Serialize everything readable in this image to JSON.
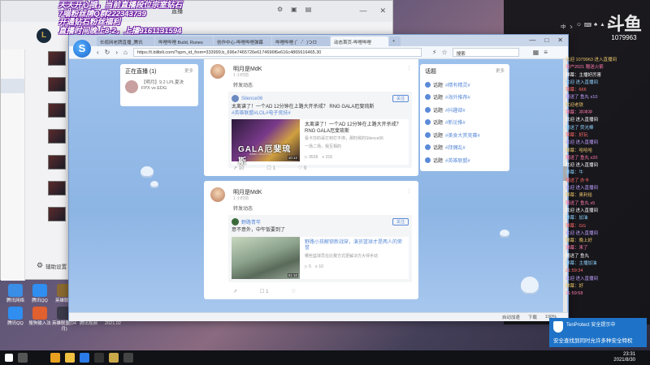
{
  "overlay": {
    "lines": [
      "天天开心哦，当前直播段位宗室钻石",
      "7喵粉丝牌Q群222343739",
      "开通钻石粉丝福利",
      "直播时间晚上8-2，上播9161131594"
    ]
  },
  "back_window": {
    "title": "英雄联盟",
    "tab_live": "直播",
    "footer_settings": "辅助设置"
  },
  "desktop_icons": [
    {
      "label": "腾讯网络"
    },
    {
      "label": "腾讯QQ"
    },
    {
      "label": "英雄联盟"
    },
    {
      "label": "腾讯QQ"
    },
    {
      "label": "搜狗输入法"
    },
    {
      "label": "英雄联盟(04月)"
    },
    {
      "label": "腾讯视频"
    },
    {
      "label": "2021.02"
    }
  ],
  "right_panel": {
    "brand": "斗鱼",
    "viewers": "1079963",
    "tray": [
      "中",
      "ゝ",
      "☺",
      "⌨",
      "♣",
      "▲",
      "■"
    ],
    "chat_lines": [
      "欢迎 1079963 进入直播间",
      "用户2021 赠送火箭",
      "弹幕：主播好厉害",
      "欢迎 进入直播间",
      "弹幕：666",
      "赠送了 鱼丸 x10",
      "欢迎老铁",
      "弹幕：冲冲冲",
      "欢迎 进入直播间",
      "赠送了 荧光棒",
      "弹幕：好玩",
      "欢迎 进入直播间",
      "弹幕：哈哈哈",
      "赠送了 鱼丸 x20",
      "欢迎 进入直播间",
      "弹幕：牛",
      "赠送了 办卡",
      "欢迎 进入直播间",
      "弹幕：奥利给",
      "赠送了 鱼丸 x5",
      "欢迎 进入直播间",
      "弹幕：加油",
      "弹幕：GG",
      "欢迎 进入直播间",
      "弹幕：晚上好",
      "弹幕：来了",
      "赠送了 鱼丸",
      "弹幕：主播加油",
      "21:59:34",
      "欢迎 进入直播间",
      "弹幕：好",
      "21:59:58"
    ]
  },
  "notification": {
    "title": "TenProtect 安全提示中",
    "body": "安全查找到同时允许多种安全特权"
  },
  "taskbar": {
    "time": "23:31",
    "date": "2021/8/30"
  },
  "browser": {
    "tabs": [
      "长缆网老牌直播_腾讯",
      "哔哩哔哩 Build, Runes",
      "创作中心-哔哩哔哩弹幕",
      "哔哩哔哩 (゜-゜)つロ",
      "动态首页-哔哩哔哩"
    ],
    "address": "https://t.bilibili.com/?spm_id_from=333999.b_696e7465726e6174696f6e616c4865616465.30",
    "search_placeholder": "搜索",
    "statusbar": [
      "自动加速",
      "下载",
      "100%"
    ]
  },
  "live_card": {
    "title": "正在直播",
    "count": "(1)",
    "more": "更多",
    "item_desc": "【明月】9.2 LPL夏决 FPX vs EDG"
  },
  "posts": [
    {
      "user": "明月是MdK",
      "time": "1 小时前",
      "action": "转发动态",
      "quoted_user": "Silence06",
      "follow": "关注",
      "quoted_text": "太离谱了！一个AD 12分钟在上路大开杀戒？ RNG GALA厄斐琉斯",
      "quoted_topic": "#英雄联盟#LOL#电子竞技#",
      "video_title": "太离谱了！一个AD 12分钟在上路大开杀戒？ RNG GALA厄斐琉斯",
      "video_sub": "看卡莎的哥打到打不停，那时候的Silence06",
      "video_sub2": "一场二场，我互相的",
      "video_stat": "▷ 9536　≡ 316",
      "thumb_title": "GALA厄斐琉斯",
      "thumb_sub": "AMIC CLUTCH",
      "thumb_dur": "10:12",
      "share": "10",
      "comment": "1",
      "like": "9"
    },
    {
      "user": "明月是MdK",
      "time": "1 小时前",
      "action": "转发动态",
      "quoted_user": "野路青年",
      "follow": "关注",
      "quoted_text": "意不意外，中午饭要到了",
      "video_title": "野路小孩解锁新战穿，演员篮球才是两人的荣誉",
      "video_sub": "哪些篮球员在比赛方式更解决方大师手动",
      "video_stat": "▷ 5　≡ 10",
      "thumb_dur": "01:10",
      "share": "",
      "comment": "1",
      "like": ""
    }
  ],
  "topics": {
    "title": "话题",
    "more": "更多",
    "items": [
      "#精有精灵#",
      "#海外推荐#",
      "#抖趣部#",
      "#新论推#",
      "#美食大赏竞赛#",
      "#拜偶乱#",
      "#英雄联盟#"
    ],
    "prefix": "话题"
  },
  "icons": {
    "refresh": "refresh-icon",
    "back": "back-icon",
    "forward": "forward-icon",
    "home": "home-icon",
    "star": "star-icon",
    "share": "share-icon",
    "comment": "comment-icon",
    "like": "like-icon"
  },
  "colors": {
    "accent": "#5b8bd8",
    "page_bg": "#8eb6e6",
    "overlay_stroke": "#6a1aa0",
    "notify": "#1e73c8"
  }
}
